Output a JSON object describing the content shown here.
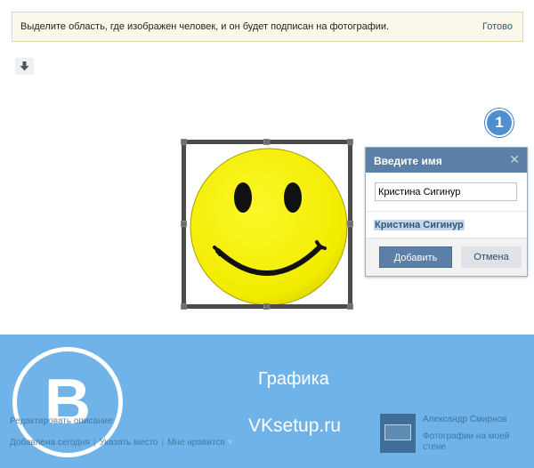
{
  "notice": {
    "text": "Выделите область, где изображен человек, и он будет подписан на фотографии.",
    "done_label": "Готово"
  },
  "badge": {
    "number": "1"
  },
  "name_dialog": {
    "title": "Введите имя",
    "input_value": "Кристина Сигинур",
    "suggestion": "Кристина Сигинур",
    "add_label": "Добавить",
    "cancel_label": "Отмена"
  },
  "banner": {
    "logo_letter": "B",
    "heading": "Графика",
    "site": "VKsetup.ru"
  },
  "photo_meta": {
    "edit_description": "Редактировать описание",
    "added": "Добавлена сегодня",
    "place_link": "Указать место",
    "like_label": "Мне нравится"
  },
  "author": {
    "name": "Александр Смирнов",
    "album_link": "Фотографии на моей стене"
  },
  "colors": {
    "accent": "#5b7fa6",
    "banner": "#6fb3e8",
    "link": "#2b587a",
    "smiley": "#f5f000"
  }
}
